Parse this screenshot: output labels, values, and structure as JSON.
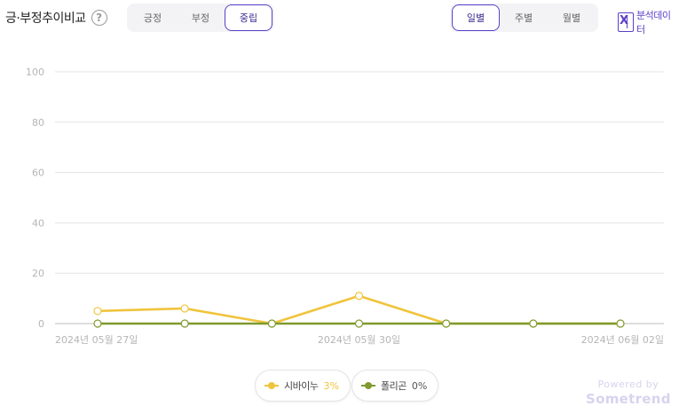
{
  "header": {
    "title": "긍·부정추이비교",
    "help_glyph": "?"
  },
  "sentiment_tabs": {
    "options": [
      "긍정",
      "부정",
      "중립"
    ],
    "active_index": 2
  },
  "period_tabs": {
    "options": [
      "일별",
      "주별",
      "월별"
    ],
    "active_index": 0
  },
  "export": {
    "label": "분석데이터"
  },
  "branding": {
    "line1": "Powered by",
    "line2": "Sometrend"
  },
  "colors": {
    "accent": "#5b3fc9",
    "series_0": "#f0c43c",
    "series_1": "#7f9a2e",
    "grid": "#e3e3e3",
    "axis_text": "#b5b5b5"
  },
  "chart_data": {
    "type": "line",
    "title": "",
    "xlabel": "",
    "ylabel": "",
    "ylim": [
      0,
      100
    ],
    "yticks": [
      "100",
      "80",
      "60",
      "40",
      "20",
      "0"
    ],
    "x": [
      "2024-05-27",
      "2024-05-28",
      "2024-05-29",
      "2024-05-30",
      "2024-05-31",
      "2024-06-01",
      "2024-06-02"
    ],
    "x_tick_labels": [
      {
        "index": 0,
        "label": "2024년 05월 27일"
      },
      {
        "index": 3,
        "label": "2024년 05월 30일"
      },
      {
        "index": 6,
        "label": "2024년 06월 02일"
      }
    ],
    "grid": true,
    "legend_position": "bottom",
    "series": [
      {
        "name": "시바이누",
        "legend_value": "3%",
        "values": [
          5,
          6,
          0,
          11,
          0,
          0,
          0
        ]
      },
      {
        "name": "폴리곤",
        "legend_value": "0%",
        "values": [
          0,
          0,
          0,
          0,
          0,
          0,
          0
        ]
      }
    ]
  }
}
